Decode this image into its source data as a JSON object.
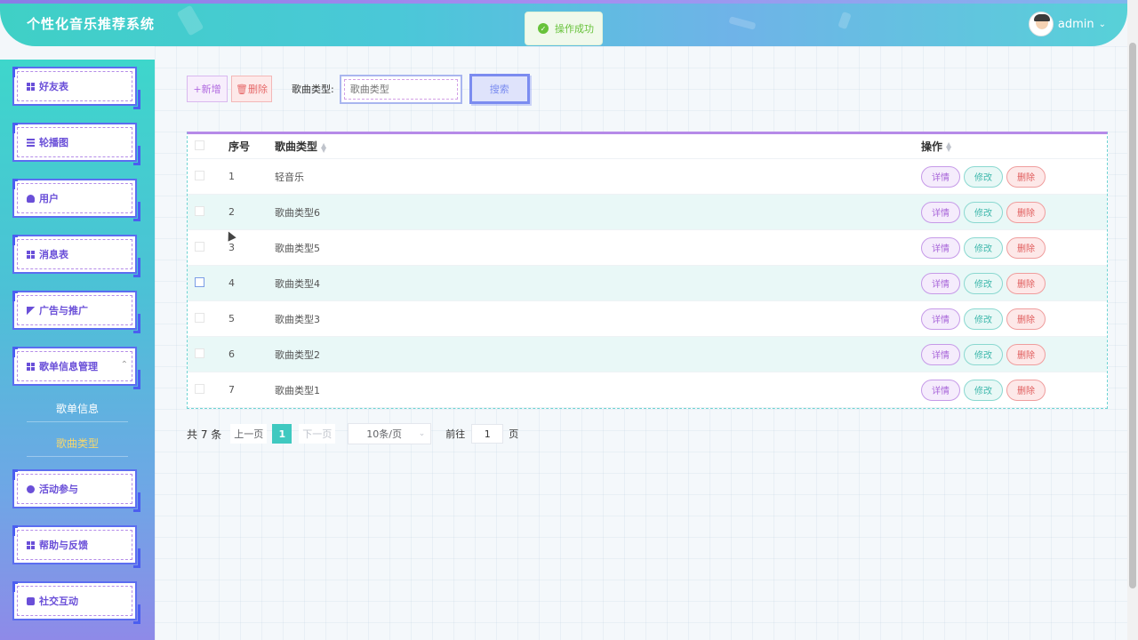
{
  "app": {
    "title": "个性化音乐推荐系统"
  },
  "user": {
    "name": "admin"
  },
  "toast": {
    "message": "操作成功"
  },
  "sidebar": {
    "items": [
      {
        "label": "好友表",
        "icon": "grid-icon"
      },
      {
        "label": "轮播图",
        "icon": "list-icon"
      },
      {
        "label": "用户",
        "icon": "user-icon"
      },
      {
        "label": "消息表",
        "icon": "grid-icon"
      },
      {
        "label": "广告与推广",
        "icon": "ad-icon"
      },
      {
        "label": "歌单信息管理",
        "icon": "apps-icon"
      },
      {
        "label": "活动参与",
        "icon": "circle-icon"
      },
      {
        "label": "帮助与反馈",
        "icon": "grid-icon"
      },
      {
        "label": "社交互动",
        "icon": "check-icon"
      }
    ],
    "submenu": [
      {
        "label": "歌单信息"
      },
      {
        "label": "歌曲类型"
      }
    ]
  },
  "toolbar": {
    "add_label": "+新增",
    "delete_label": "删除",
    "filter_label": "歌曲类型:",
    "filter_placeholder": "歌曲类型",
    "search_label": "搜索"
  },
  "table": {
    "headers": {
      "index": "序号",
      "type": "歌曲类型",
      "ops": "操作"
    },
    "rows": [
      {
        "index": "1",
        "type": "轻音乐"
      },
      {
        "index": "2",
        "type": "歌曲类型6"
      },
      {
        "index": "3",
        "type": "歌曲类型5"
      },
      {
        "index": "4",
        "type": "歌曲类型4"
      },
      {
        "index": "5",
        "type": "歌曲类型3"
      },
      {
        "index": "6",
        "type": "歌曲类型2"
      },
      {
        "index": "7",
        "type": "歌曲类型1"
      }
    ],
    "ops": {
      "detail": "详情",
      "edit": "修改",
      "remove": "删除"
    }
  },
  "pager": {
    "total": "共 7 条",
    "prev": "上一页",
    "current": "1",
    "next": "下一页",
    "size": "10条/页",
    "goto": "前往",
    "goto_value": "1",
    "unit": "页"
  }
}
